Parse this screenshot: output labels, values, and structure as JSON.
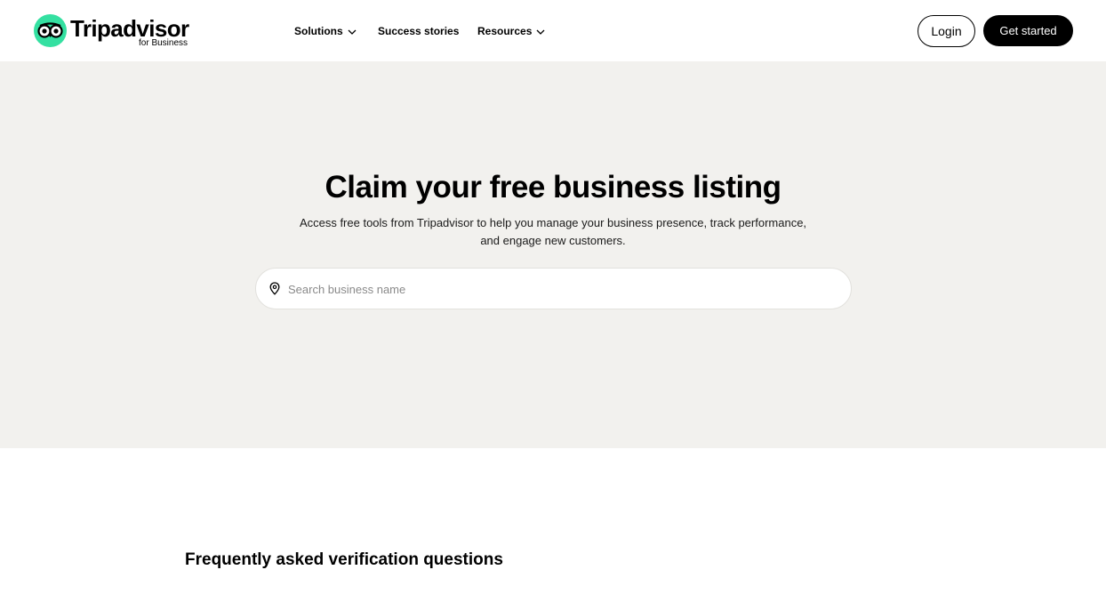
{
  "header": {
    "logo": {
      "name": "Tripadvisor",
      "sub": "for Business"
    },
    "nav": [
      {
        "label": "Solutions",
        "has_dropdown": true
      },
      {
        "label": "Success stories",
        "has_dropdown": false
      },
      {
        "label": "Resources",
        "has_dropdown": true
      }
    ],
    "login_label": "Login",
    "get_started_label": "Get started"
  },
  "hero": {
    "title": "Claim your free business listing",
    "subtitle_line1": "Access free tools from Tripadvisor to help you manage your business presence, track performance,",
    "subtitle_line2": "and engage new customers.",
    "search": {
      "placeholder": "Search business name",
      "value": "",
      "icon": "location-pin-icon"
    }
  },
  "faq": {
    "title": "Frequently asked verification questions"
  },
  "colors": {
    "brand_green": "#34e0a1",
    "hero_bg": "#f2f1ee",
    "button_dark": "#000000"
  }
}
